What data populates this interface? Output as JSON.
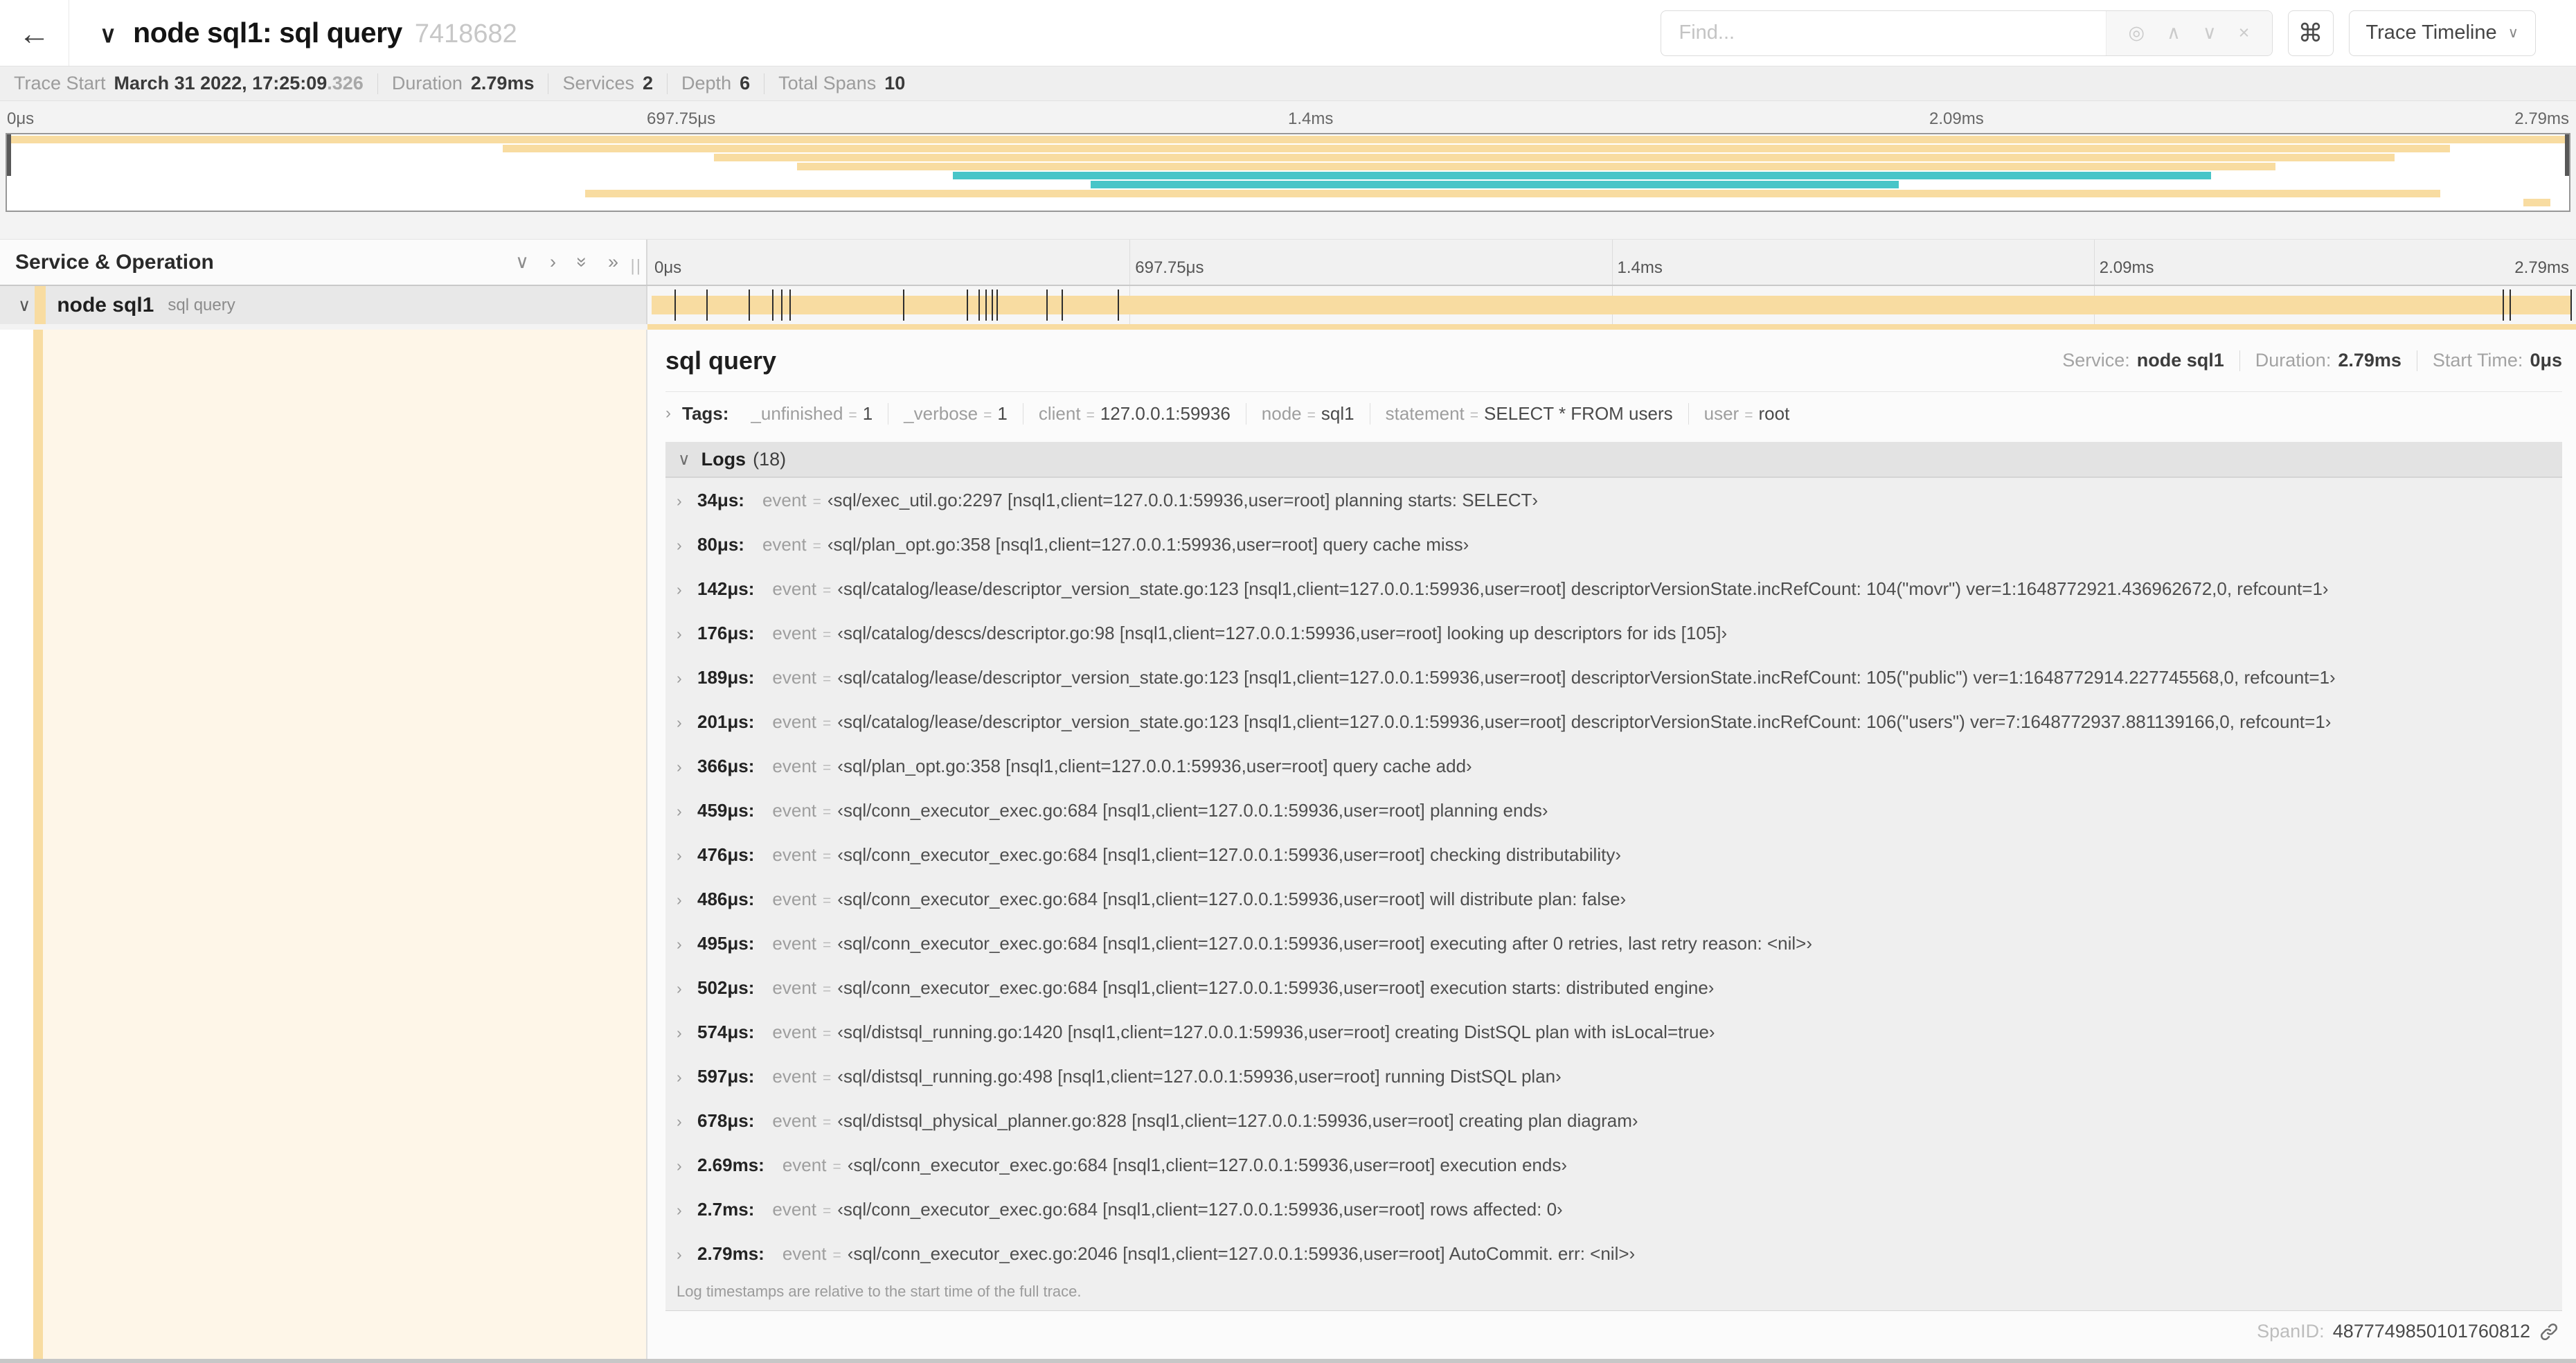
{
  "icons": {
    "back": "←",
    "collapse": "∨",
    "chevron_down": "∨",
    "chevron_right": "›",
    "double_chevron_right": "»",
    "find_target": "◎",
    "find_prev": "∧",
    "find_next": "∨",
    "find_clear": "×",
    "command": "⌘",
    "dropdown": "∨",
    "resizer": "||"
  },
  "header": {
    "title": "node sql1: sql query",
    "trace_id": "7418682",
    "find_placeholder": "Find...",
    "view_selector": "Trace Timeline"
  },
  "trace_stats": [
    {
      "label": "Trace Start",
      "value": "March 31 2022, 17:25:09",
      "suffix": ".326"
    },
    {
      "label": "Duration",
      "value": "2.79ms",
      "suffix": ""
    },
    {
      "label": "Services",
      "value": "2",
      "suffix": ""
    },
    {
      "label": "Depth",
      "value": "6",
      "suffix": ""
    },
    {
      "label": "Total Spans",
      "value": "10",
      "suffix": ""
    }
  ],
  "timeline": {
    "ticks": [
      "0μs",
      "697.75μs",
      "1.4ms",
      "2.09ms",
      "2.79ms"
    ],
    "duration_us": 2790
  },
  "minimap": {
    "duration_ms": 2.79,
    "rows": [
      {
        "start_ms": 0.0,
        "end_ms": 2.79,
        "color": "tan"
      },
      {
        "start_ms": 0.54,
        "end_ms": 2.66,
        "color": "tan"
      },
      {
        "start_ms": 0.77,
        "end_ms": 2.6,
        "color": "tan"
      },
      {
        "start_ms": 0.86,
        "end_ms": 2.47,
        "color": "tan"
      },
      {
        "start_ms": 1.03,
        "end_ms": 2.4,
        "color": "teal"
      },
      {
        "start_ms": 1.18,
        "end_ms": 2.06,
        "color": "teal"
      },
      {
        "start_ms": 0.63,
        "end_ms": 2.65,
        "color": "tan"
      },
      {
        "start_ms": 2.74,
        "end_ms": 2.77,
        "color": "tan"
      }
    ]
  },
  "left_panel": {
    "header": "Service & Operation",
    "row": {
      "service": "node sql1",
      "operation": "sql query"
    }
  },
  "span_detail": {
    "title": "sql query",
    "meta": [
      {
        "label": "Service:",
        "value": "node sql1"
      },
      {
        "label": "Duration:",
        "value": "2.79ms"
      },
      {
        "label": "Start Time:",
        "value": "0μs"
      }
    ],
    "tags_label": "Tags:",
    "eq": "=",
    "tags": [
      {
        "key": "_unfinished",
        "value": "1"
      },
      {
        "key": "_verbose",
        "value": "1"
      },
      {
        "key": "client",
        "value": "127.0.0.1:59936"
      },
      {
        "key": "node",
        "value": "sql1"
      },
      {
        "key": "statement",
        "value": "SELECT * FROM users"
      },
      {
        "key": "user",
        "value": "root"
      }
    ],
    "logs_label": "Logs",
    "logs_count": "(18)",
    "log_key": "event",
    "logs": [
      {
        "time": "34μs:",
        "t_us": 34,
        "value": "‹sql/exec_util.go:2297 [nsql1,client=127.0.0.1:59936,user=root] planning starts: SELECT›"
      },
      {
        "time": "80μs:",
        "t_us": 80,
        "value": "‹sql/plan_opt.go:358 [nsql1,client=127.0.0.1:59936,user=root] query cache miss›"
      },
      {
        "time": "142μs:",
        "t_us": 142,
        "value": "‹sql/catalog/lease/descriptor_version_state.go:123 [nsql1,client=127.0.0.1:59936,user=root] descriptorVersionState.incRefCount: 104(\"movr\") ver=1:1648772921.436962672,0, refcount=1›"
      },
      {
        "time": "176μs:",
        "t_us": 176,
        "value": "‹sql/catalog/descs/descriptor.go:98 [nsql1,client=127.0.0.1:59936,user=root] looking up descriptors for ids [105]›"
      },
      {
        "time": "189μs:",
        "t_us": 189,
        "value": "‹sql/catalog/lease/descriptor_version_state.go:123 [nsql1,client=127.0.0.1:59936,user=root] descriptorVersionState.incRefCount: 105(\"public\") ver=1:1648772914.227745568,0, refcount=1›"
      },
      {
        "time": "201μs:",
        "t_us": 201,
        "value": "‹sql/catalog/lease/descriptor_version_state.go:123 [nsql1,client=127.0.0.1:59936,user=root] descriptorVersionState.incRefCount: 106(\"users\") ver=7:1648772937.881139166,0, refcount=1›"
      },
      {
        "time": "366μs:",
        "t_us": 366,
        "value": "‹sql/plan_opt.go:358 [nsql1,client=127.0.0.1:59936,user=root] query cache add›"
      },
      {
        "time": "459μs:",
        "t_us": 459,
        "value": "‹sql/conn_executor_exec.go:684 [nsql1,client=127.0.0.1:59936,user=root] planning ends›"
      },
      {
        "time": "476μs:",
        "t_us": 476,
        "value": "‹sql/conn_executor_exec.go:684 [nsql1,client=127.0.0.1:59936,user=root] checking distributability›"
      },
      {
        "time": "486μs:",
        "t_us": 486,
        "value": "‹sql/conn_executor_exec.go:684 [nsql1,client=127.0.0.1:59936,user=root] will distribute plan: false›"
      },
      {
        "time": "495μs:",
        "t_us": 495,
        "value": "‹sql/conn_executor_exec.go:684 [nsql1,client=127.0.0.1:59936,user=root] executing after 0 retries, last retry reason: <nil>›"
      },
      {
        "time": "502μs:",
        "t_us": 502,
        "value": "‹sql/conn_executor_exec.go:684 [nsql1,client=127.0.0.1:59936,user=root] execution starts: distributed engine›"
      },
      {
        "time": "574μs:",
        "t_us": 574,
        "value": "‹sql/distsql_running.go:1420 [nsql1,client=127.0.0.1:59936,user=root] creating DistSQL plan with isLocal=true›"
      },
      {
        "time": "597μs:",
        "t_us": 597,
        "value": "‹sql/distsql_running.go:498 [nsql1,client=127.0.0.1:59936,user=root] running DistSQL plan›"
      },
      {
        "time": "678μs:",
        "t_us": 678,
        "value": "‹sql/distsql_physical_planner.go:828 [nsql1,client=127.0.0.1:59936,user=root] creating plan diagram›"
      },
      {
        "time": "2.69ms:",
        "t_us": 2690,
        "value": "‹sql/conn_executor_exec.go:684 [nsql1,client=127.0.0.1:59936,user=root] execution ends›"
      },
      {
        "time": "2.7ms:",
        "t_us": 2700,
        "value": "‹sql/conn_executor_exec.go:684 [nsql1,client=127.0.0.1:59936,user=root] rows affected: 0›"
      },
      {
        "time": "2.79ms:",
        "t_us": 2790,
        "value": "‹sql/conn_executor_exec.go:2046 [nsql1,client=127.0.0.1:59936,user=root] AutoCommit. err: <nil>›"
      }
    ],
    "footnote": "Log timestamps are relative to the start time of the full trace.",
    "spanid_label": "SpanID:",
    "spanid": "4877749850101760812"
  },
  "colors": {
    "tan": "#F8DCA1",
    "teal": "#48C5C8",
    "cream": "#FEF6E8"
  }
}
